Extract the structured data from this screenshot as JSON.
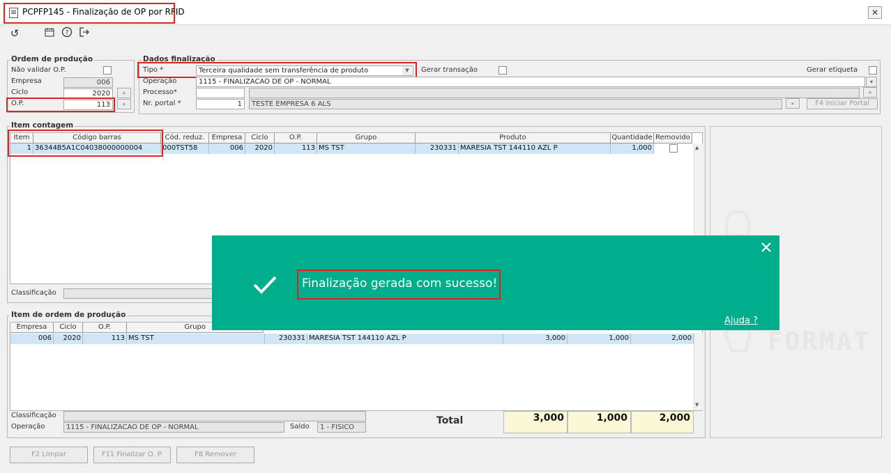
{
  "window": {
    "title": "PCPFP145 - Finalização de OP por RFID"
  },
  "toolbar": {
    "items": [
      "refresh-icon",
      "calendar-icon",
      "help-icon",
      "exit-icon"
    ]
  },
  "ordem": {
    "legend": "Ordem de produção",
    "nao_validar_label": "Não validar O.P.",
    "empresa_label": "Empresa",
    "empresa_value": "006",
    "ciclo_label": "Ciclo",
    "ciclo_value": "2020",
    "op_label": "O.P.",
    "op_value": "113"
  },
  "dados": {
    "legend": "Dados finalização",
    "tipo_label": "Tipo *",
    "tipo_value": "Terceira qualidade sem transferência de produto",
    "gerar_transacao_label": "Gerar transação",
    "gerar_etiqueta_label": "Gerar etiqueta",
    "operacao_label": "Operação",
    "operacao_value": "1115 - FINALIZACAO DE OP - NORMAL",
    "processo_label": "Processo*",
    "processo_value": "",
    "portal_label": "Nr. portal *",
    "portal_value": "1",
    "portal_desc": "TESTE EMPRESA 6 ALS",
    "iniciar_portal_label": "F4 Iniciar Portal"
  },
  "item_contagem": {
    "legend": "Item contagem",
    "headers": [
      "Item",
      "Código barras",
      "Cód. reduz.",
      "Empresa",
      "Ciclo",
      "O.P.",
      "Grupo",
      "Produto",
      "Quantidade",
      "Removido"
    ],
    "row": {
      "item": "1",
      "barcode": "36344B5A1C04038000000004",
      "cod_reduz": "000TST58",
      "empresa": "006",
      "ciclo": "2020",
      "op": "113",
      "grupo": "MS TST",
      "produto_cod": "230331",
      "produto_desc": "MARESIA TST 144110 AZL P",
      "quantidade": "1,000"
    },
    "classificacao_label": "Classificação"
  },
  "item_ordem": {
    "legend": "Item de ordem de produção",
    "headers": [
      "Empresa",
      "Ciclo",
      "O.P.",
      "Grupo"
    ],
    "row": {
      "empresa": "006",
      "ciclo": "2020",
      "op": "113",
      "grupo": "MS TST",
      "produto_cod": "230331",
      "produto_desc": "MARESIA TST 144110 AZL P",
      "q1": "3,000",
      "q2": "1,000",
      "q3": "2,000"
    },
    "classificacao_label": "Classificação",
    "operacao_label": "Operação",
    "operacao_value": "1115 - FINALIZACAO DE OP - NORMAL",
    "saldo_label": "Saldo",
    "saldo_value": "1 - FISICO"
  },
  "totals": {
    "label": "Total",
    "v1": "3,000",
    "v2": "1,000",
    "v3": "2,000"
  },
  "buttons": {
    "limpar": "F2 Limpar",
    "finalizar": "F11 Finalizar O. P.",
    "remover": "F8 Remover"
  },
  "toast": {
    "message": "Finalização gerada com sucesso!",
    "help_link": "Ajuda ?",
    "color": "#00ae8b"
  },
  "watermark": {
    "text": "FORMAT"
  }
}
